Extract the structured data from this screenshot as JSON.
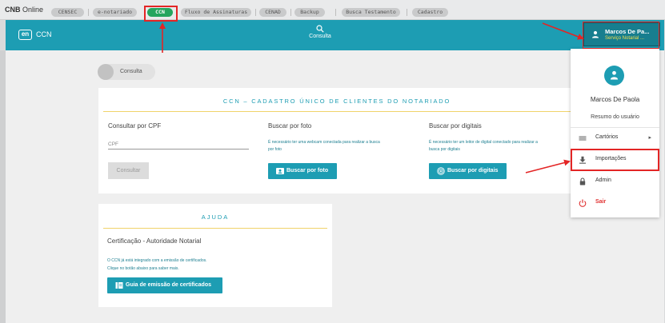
{
  "brand": {
    "name": "CNB",
    "suffix": "Online"
  },
  "tabs": [
    {
      "label": "CENSEC"
    },
    {
      "label": "e-notariado"
    },
    {
      "label": "CCN",
      "active": true
    },
    {
      "label": "Fluxo de Assinaturas"
    },
    {
      "label": "CENAD"
    },
    {
      "label": "Backup"
    },
    {
      "label": "Busca Testamento"
    },
    {
      "label": "Cadastro"
    }
  ],
  "header": {
    "logo_mark": "en",
    "app_name": "CCN",
    "search_label": "Consulta",
    "search_icon": "search-icon",
    "user": {
      "name": "Marcos De Pa...",
      "office": "Serviço Notarial ...",
      "icon": "user-icon"
    }
  },
  "breadcrumb_chip": {
    "label": "Consulta"
  },
  "main_card": {
    "title": "CCN – CADASTRO ÚNICO DE CLIENTES DO NOTARIADO",
    "cpf": {
      "title": "Consultar por CPF",
      "placeholder": "CPF",
      "button": "Consultar"
    },
    "photo": {
      "title": "Buscar por foto",
      "hint_line1": "É necessário ter uma webcam conectada para realizar a busca",
      "hint_line2": "por foto",
      "button": "Buscar por foto",
      "button_icon": "contact-card-icon"
    },
    "digital": {
      "title": "Buscar por digitais",
      "hint_line1": "É necessário ter um leitor de digital conectado para realizar a",
      "hint_line2": "busca por digitais",
      "button": "Buscar por digitais",
      "button_icon": "fingerprint-icon"
    }
  },
  "help_card": {
    "title": "AJUDA",
    "subtitle": "Certificação - Autoridade Notarial",
    "hint_line1": "O CCN já está integrado com a emissão de certificados.",
    "hint_line2": "Clique no botão abaixo para saber mais.",
    "button": "Guia de emissão de certificados",
    "button_icon": "book-icon"
  },
  "user_menu": {
    "full_name": "Marcos De Paola",
    "summary": "Resumo do usuário",
    "items": [
      {
        "label": "Cartórios",
        "icon": "list-icon",
        "has_submenu": true
      },
      {
        "label": "Importações",
        "icon": "download-icon",
        "highlighted": true
      },
      {
        "label": "Admin",
        "icon": "lock-icon"
      },
      {
        "label": "Sair",
        "icon": "power-icon",
        "danger": true
      }
    ]
  },
  "colors": {
    "accent": "#1d9db3",
    "accent_dark": "#177e8f",
    "tab_active": "#23a55e",
    "annotation": "#e32525",
    "user_subtitle": "#f3de4a",
    "exit": "#e03131",
    "rule": "#f0d36a"
  }
}
